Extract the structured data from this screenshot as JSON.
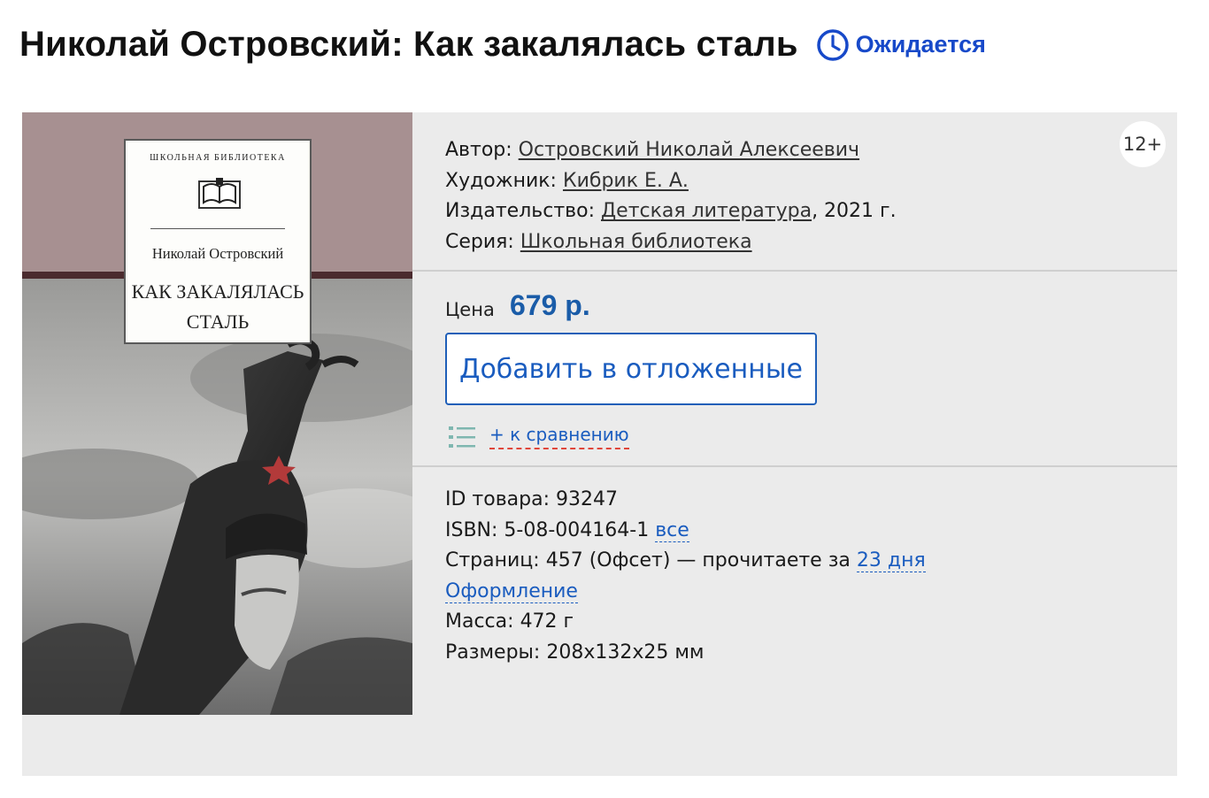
{
  "header": {
    "title": "Николай Островский: Как закалялась сталь",
    "status": "Ожидается"
  },
  "cover": {
    "series": "ШКОЛЬНАЯ БИБЛИОТЕКА",
    "author": "Николай Островский",
    "title_line1": "КАК ЗАКАЛЯЛАСЬ",
    "title_line2": "СТАЛЬ"
  },
  "age": "12+",
  "meta": {
    "author_label": "Автор:",
    "author_value": "Островский Николай Алексеевич",
    "artist_label": "Художник:",
    "artist_value": "Кибрик Е. А.",
    "publisher_label": "Издательство:",
    "publisher_value": "Детская литература",
    "publisher_year": ", 2021 г.",
    "series_label": "Серия:",
    "series_value": "Школьная библиотека"
  },
  "price": {
    "label": "Цена",
    "value": "679 р."
  },
  "actions": {
    "defer_button": "Добавить в отложенные",
    "compare": "+ к сравнению"
  },
  "details": {
    "id_label": "ID товара:",
    "id_value": "93247",
    "isbn_label": "ISBN:",
    "isbn_value": "5-08-004164-1",
    "isbn_all": "все",
    "pages_label": "Страниц:",
    "pages_value": "457 (Офсет) — прочитаете за",
    "read_time": "23 дня",
    "design": "Оформление",
    "mass_label": "Масса:",
    "mass_value": "472 г",
    "size_label": "Размеры:",
    "size_value": "208x132x25 мм"
  },
  "colors": {
    "accent_blue": "#1a5cbf",
    "status_blue": "#1749c9",
    "price_blue": "#1a5ca8",
    "card_bg": "#ebebeb"
  }
}
